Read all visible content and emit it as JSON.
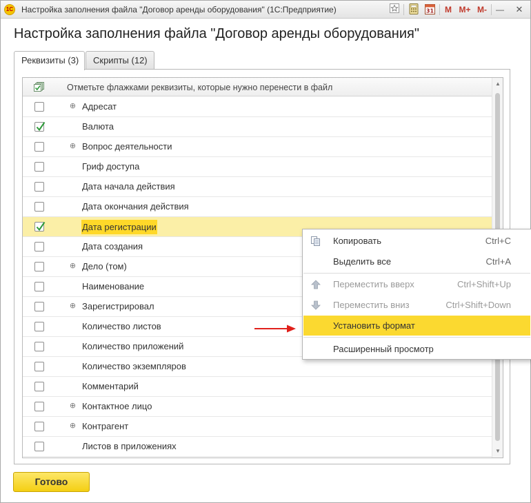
{
  "window": {
    "title": "Настройка заполнения файла \"Договор аренды оборудования\"  (1С:Предприятие)",
    "logo_text": "1С",
    "toolbar": {
      "mem_m": "M",
      "mem_mplus": "M+",
      "mem_mminus": "M-",
      "minimize": "—",
      "maximize": "□",
      "close": "✕"
    }
  },
  "page_title": "Настройка заполнения файла \"Договор аренды оборудования\"",
  "tabs": [
    {
      "label": "Реквизиты (3)",
      "active": true
    },
    {
      "label": "Скрипты (12)",
      "active": false
    }
  ],
  "grid": {
    "header": "Отметьте флажками реквизиты, которые нужно перенести в файл",
    "rows": [
      {
        "label": "Адресат",
        "checked": false,
        "expandable": true
      },
      {
        "label": "Валюта",
        "checked": true,
        "expandable": false
      },
      {
        "label": "Вопрос деятельности",
        "checked": false,
        "expandable": true
      },
      {
        "label": "Гриф доступа",
        "checked": false,
        "expandable": false
      },
      {
        "label": "Дата начала действия",
        "checked": false,
        "expandable": false
      },
      {
        "label": "Дата окончания действия",
        "checked": false,
        "expandable": false
      },
      {
        "label": "Дата регистрации",
        "checked": true,
        "expandable": false,
        "selected": true
      },
      {
        "label": "Дата создания",
        "checked": false,
        "expandable": false
      },
      {
        "label": "Дело (том)",
        "checked": false,
        "expandable": true
      },
      {
        "label": "Наименование",
        "checked": false,
        "expandable": false
      },
      {
        "label": "Зарегистрировал",
        "checked": false,
        "expandable": true
      },
      {
        "label": "Количество листов",
        "checked": false,
        "expandable": false
      },
      {
        "label": "Количество приложений",
        "checked": false,
        "expandable": false
      },
      {
        "label": "Количество экземпляров",
        "checked": false,
        "expandable": false
      },
      {
        "label": "Комментарий",
        "checked": false,
        "expandable": false
      },
      {
        "label": "Контактное лицо",
        "checked": false,
        "expandable": true
      },
      {
        "label": "Контрагент",
        "checked": false,
        "expandable": true
      },
      {
        "label": "Листов в приложениях",
        "checked": false,
        "expandable": false
      }
    ]
  },
  "context_menu": {
    "items": [
      {
        "label": "Копировать",
        "shortcut": "Ctrl+C",
        "icon": "copy-icon"
      },
      {
        "label": "Выделить все",
        "shortcut": "Ctrl+A"
      },
      {
        "label": "Переместить вверх",
        "shortcut": "Ctrl+Shift+Up",
        "icon": "arrow-up-icon",
        "disabled": true
      },
      {
        "label": "Переместить вниз",
        "shortcut": "Ctrl+Shift+Down",
        "icon": "arrow-down-icon",
        "disabled": true
      },
      {
        "label": "Установить формат",
        "shortcut": "",
        "highlight": true
      },
      {
        "label": "Расширенный просмотр",
        "shortcut": ""
      }
    ]
  },
  "footer": {
    "done_label": "Готово"
  },
  "colors": {
    "accent_yellow": "#fbd930",
    "selection_row": "#fbefa7",
    "check_green": "#2e9a3a",
    "annotation_arrow": "#e0201b"
  }
}
